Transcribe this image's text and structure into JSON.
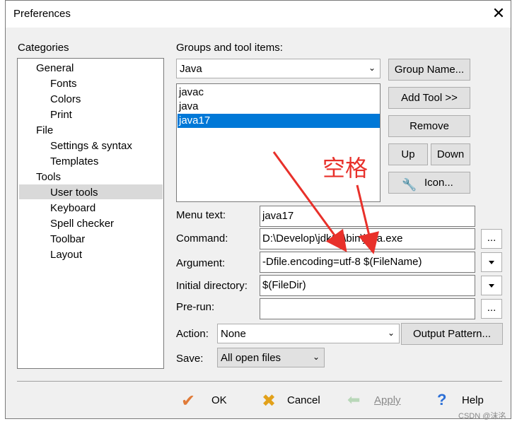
{
  "window": {
    "title": "Preferences",
    "close": "✕"
  },
  "categories": {
    "label": "Categories",
    "items": [
      "General",
      "Fonts",
      "Colors",
      "Print",
      "File",
      "Settings & syntax",
      "Templates",
      "Tools",
      "User tools",
      "Keyboard",
      "Spell checker",
      "Toolbar",
      "Layout"
    ],
    "selected": "User tools"
  },
  "groups": {
    "label": "Groups and tool items:",
    "selected_group": "Java",
    "tools": [
      "javac",
      "java",
      "java17"
    ],
    "selected_tool": "java17"
  },
  "buttons": {
    "group_name": "Group Name...",
    "add_tool": "Add Tool >>",
    "remove": "Remove",
    "up": "Up",
    "down": "Down",
    "icon": "Icon...",
    "browse": "...",
    "output_pattern": "Output Pattern...",
    "ok": "OK",
    "cancel": "Cancel",
    "apply": "Apply",
    "help": "Help"
  },
  "fields": {
    "menu_text_label": "Menu text:",
    "menu_text": "java17",
    "command_label": "Command:",
    "command": "D:\\Develop\\jdk17\\bin\\java.exe",
    "argument_label": "Argument:",
    "argument": "-Dfile.encoding=utf-8 $(FileName)",
    "initial_dir_label": "Initial directory:",
    "initial_dir": "$(FileDir)",
    "prerun_label": "Pre-run:",
    "prerun": "",
    "action_label": "Action:",
    "action": "None",
    "save_label": "Save:",
    "save": "All open files"
  },
  "annotation": {
    "text": "空格",
    "color": "#e8302a"
  },
  "watermark": "CSDN @沫洺",
  "colors": {
    "selection": "#0078d7",
    "ok_check": "#e07b39",
    "cancel_x": "#e2a11a",
    "help": "#2c6fd6"
  }
}
